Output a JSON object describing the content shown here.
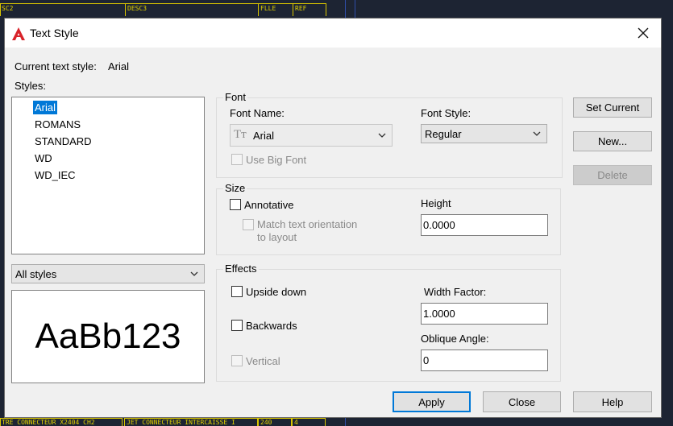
{
  "background": {
    "top_cells": [
      "SC2",
      "DESC3",
      "FLLE",
      "REF"
    ],
    "bottom_cells": [
      "TRE CONNECTEUR X2404 CH2",
      "JET CONNECTEUR INTERCAISSE I",
      "240",
      "4"
    ]
  },
  "dialog": {
    "title": "Text Style",
    "current_style_label": "Current text style:",
    "current_style_value": "Arial",
    "styles_label": "Styles:",
    "styles": [
      "Arial",
      "ROMANS",
      "STANDARD",
      "WD",
      "WD_IEC"
    ],
    "selected_style": "Arial",
    "filter_value": "All styles",
    "preview_text": "AaBb123",
    "font": {
      "group_label": "Font",
      "font_name_label": "Font Name:",
      "font_name_value": "Arial",
      "font_style_label": "Font Style:",
      "font_style_value": "Regular",
      "use_big_font_label": "Use Big Font"
    },
    "size": {
      "group_label": "Size",
      "annotative_label": "Annotative",
      "match_orientation_line1": "Match text orientation",
      "match_orientation_line2": "to layout",
      "height_label": "Height",
      "height_value": "0.0000"
    },
    "effects": {
      "group_label": "Effects",
      "upside_down_label": "Upside down",
      "backwards_label": "Backwards",
      "vertical_label": "Vertical",
      "width_factor_label": "Width Factor:",
      "width_factor_value": "1.0000",
      "oblique_angle_label": "Oblique Angle:",
      "oblique_angle_value": "0"
    },
    "buttons": {
      "set_current": "Set Current",
      "new": "New...",
      "delete": "Delete",
      "apply": "Apply",
      "close": "Close",
      "help": "Help"
    }
  },
  "colors": {
    "accent": "#0078d7",
    "cad_background": "#1d2433",
    "cad_lines": "#d8c400"
  }
}
